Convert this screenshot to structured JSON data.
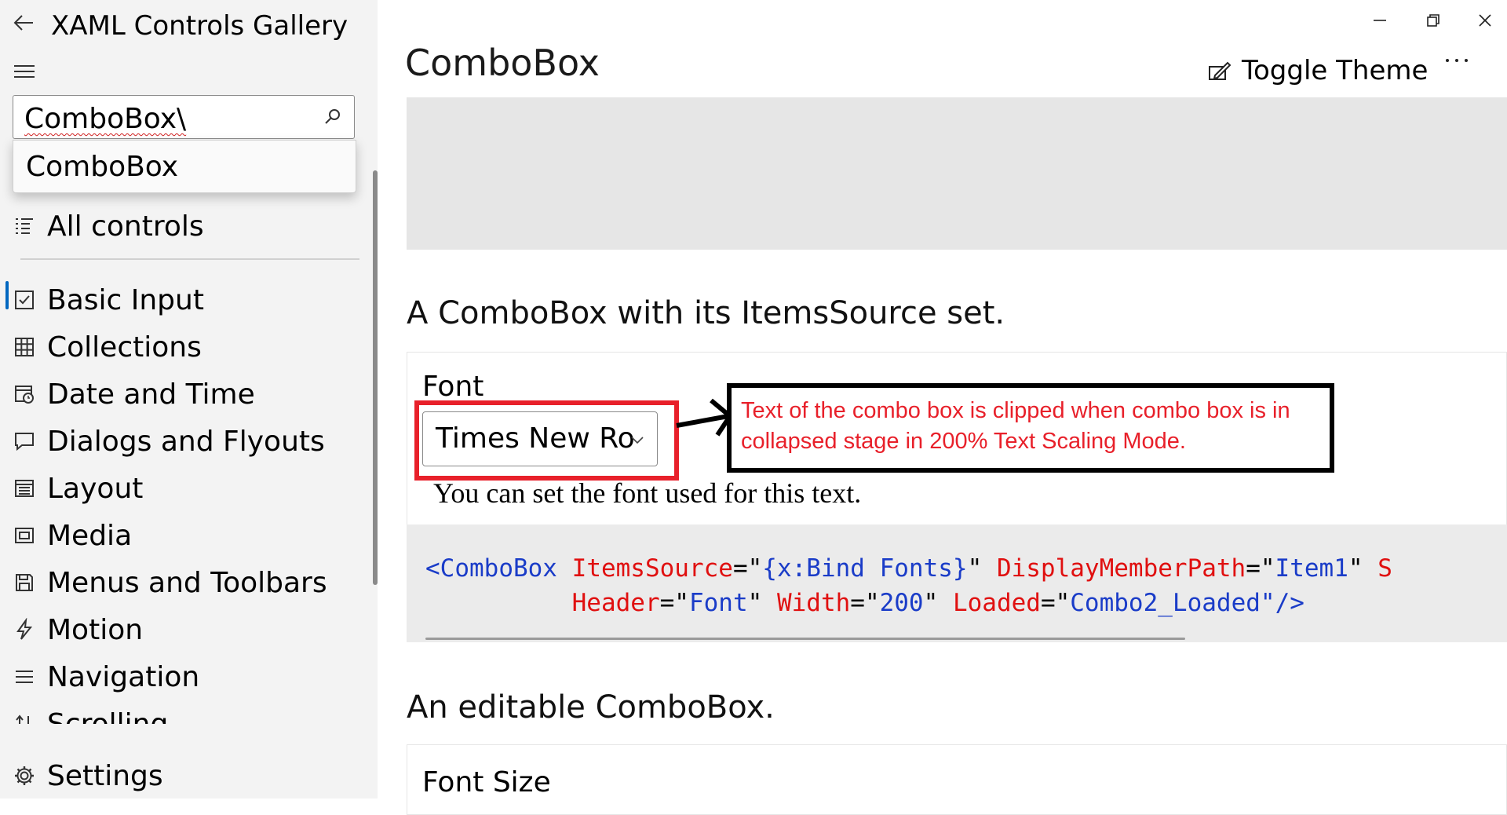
{
  "app": {
    "title": "XAML Controls Gallery"
  },
  "search": {
    "value": "ComboBox\\",
    "suggestion": "ComboBox"
  },
  "nav": {
    "all_controls": "All controls",
    "items": [
      {
        "label": "Basic Input",
        "icon": "checkbox-icon"
      },
      {
        "label": "Collections",
        "icon": "grid-icon"
      },
      {
        "label": "Date and Time",
        "icon": "calendar-clock-icon"
      },
      {
        "label": "Dialogs and Flyouts",
        "icon": "message-icon"
      },
      {
        "label": "Layout",
        "icon": "layout-icon"
      },
      {
        "label": "Media",
        "icon": "media-icon"
      },
      {
        "label": "Menus and Toolbars",
        "icon": "save-icon"
      },
      {
        "label": "Motion",
        "icon": "lightning-icon"
      },
      {
        "label": "Navigation",
        "icon": "navigation-icon"
      },
      {
        "label": "Scrolling",
        "icon": "scroll-icon"
      }
    ],
    "selected": "Basic Input",
    "settings": "Settings"
  },
  "page": {
    "title": "ComboBox",
    "toggle_theme": "Toggle Theme",
    "more": "···"
  },
  "example1": {
    "title": "A ComboBox with its ItemsSource set.",
    "header": "Font",
    "combo_value": "Times New Ro",
    "sample_text": "You can set the font used for this text.",
    "code": {
      "l1_tag": "<ComboBox",
      "l1_a1": "ItemsSource",
      "l1_e1": "=\"",
      "l1_v1": "{x:Bind Fonts}",
      "l1_q1": "\"",
      "l1_a2": "DisplayMemberPath",
      "l1_e2": "=\"",
      "l1_v2": "Item1",
      "l1_q2": "\"",
      "l1_a3": "S",
      "l2_a1": "Header",
      "l2_e1": "=\"",
      "l2_v1": "Font",
      "l2_q1": "\"",
      "l2_a2": "Width",
      "l2_e2": "=\"",
      "l2_v2": "200",
      "l2_q2": "\"",
      "l2_a3": "Loaded",
      "l2_e3": "=\"",
      "l2_v3": "Combo2_Loaded",
      "l2_end": "\"/>"
    }
  },
  "example2": {
    "title": "An editable ComboBox.",
    "header": "Font Size"
  },
  "annotation": {
    "text": "Text of the combo box is clipped when combo box is in collapsed stage in 200% Text Scaling Mode."
  },
  "colors": {
    "accent": "#0067c0",
    "code_tag": "#1a3cc8",
    "code_attr": "#e01010",
    "code_value": "#1a3cc8",
    "annotation_red": "#e8202a"
  }
}
